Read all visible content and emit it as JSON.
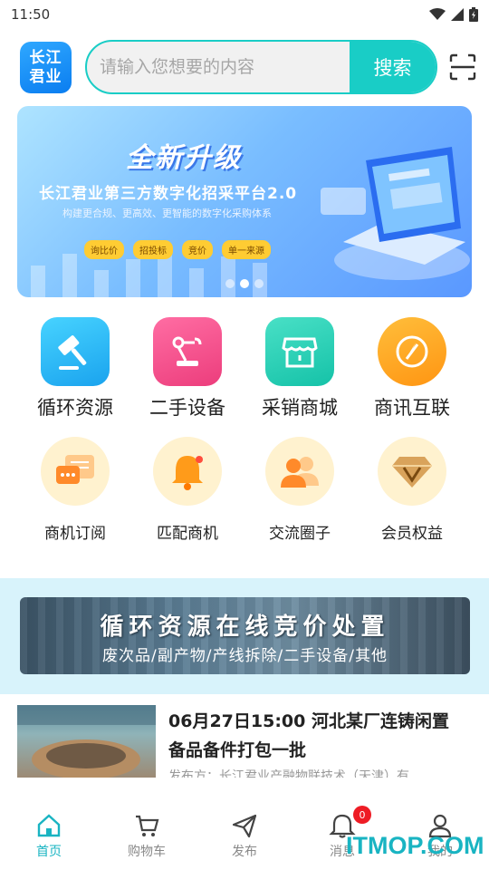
{
  "status_bar": {
    "time": "11:50"
  },
  "header": {
    "logo_line1": "长江",
    "logo_line2": "君业",
    "search_placeholder": "请输入您想要的内容",
    "search_button": "搜索"
  },
  "banner": {
    "upgrade": "全新升级",
    "headline": "长江君业第三方数字化招采平台2.0",
    "subline": "构建更合规、更高效、更智能的数字化采购体系",
    "chips": [
      "询比价",
      "招投标",
      "竞价",
      "单一来源"
    ],
    "page_count": 3,
    "active_page": 2
  },
  "main_grid": [
    {
      "label": "循环资源",
      "icon": "gavel-icon",
      "color": "#25b6ef"
    },
    {
      "label": "二手设备",
      "icon": "robot-arm-icon",
      "color": "#f0508f"
    },
    {
      "label": "采销商城",
      "icon": "storefront-icon",
      "color": "#1fcfb8"
    },
    {
      "label": "商讯互联",
      "icon": "compass-icon",
      "color": "#ffa41a"
    }
  ],
  "secondary_grid": [
    {
      "label": "商机订阅",
      "icon": "chat-bubbles-icon"
    },
    {
      "label": "匹配商机",
      "icon": "bell-icon"
    },
    {
      "label": "交流圈子",
      "icon": "people-icon"
    },
    {
      "label": "会员权益",
      "icon": "diamond-icon"
    }
  ],
  "promo": {
    "title": "循环资源在线竞价处置",
    "subtitle": "废次品/副产物/产线拆除/二手设备/其他"
  },
  "news": {
    "title": "06月27日15:00 河北某厂连铸闲置备品备件打包一批",
    "meta": "发布方：长江君业产融物联技术（天津）有"
  },
  "tabbar": {
    "tabs": [
      {
        "label": "首页",
        "icon": "home-icon"
      },
      {
        "label": "购物车",
        "icon": "cart-icon"
      },
      {
        "label": "发布",
        "icon": "send-icon"
      },
      {
        "label": "消息",
        "icon": "bell-icon"
      },
      {
        "label": "我的",
        "icon": "user-icon"
      }
    ],
    "active": 0,
    "message_badge": "0"
  },
  "watermark": "ITMOP.COM",
  "colors": {
    "accent": "#19cdc6",
    "tab_active": "#19b4c2",
    "badge": "#ee1c25"
  }
}
